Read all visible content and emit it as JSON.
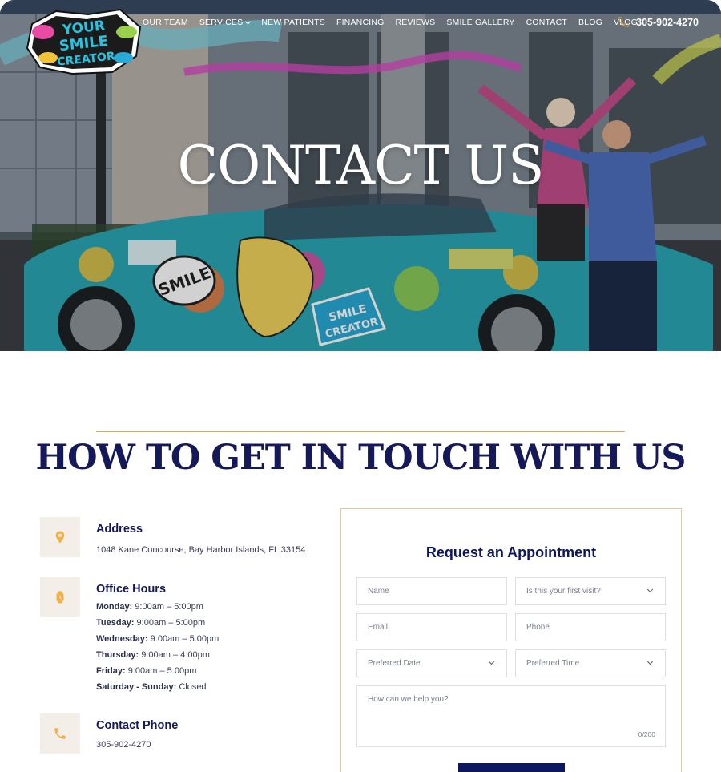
{
  "brand": {
    "logo_lines": [
      "YOUR",
      "SMILE",
      "CREATOR"
    ]
  },
  "nav": {
    "items": [
      {
        "label": "OUR TEAM",
        "has_dropdown": false
      },
      {
        "label": "SERVICES",
        "has_dropdown": true
      },
      {
        "label": "NEW PATIENTS",
        "has_dropdown": false
      },
      {
        "label": "FINANCING",
        "has_dropdown": false
      },
      {
        "label": "REVIEWS",
        "has_dropdown": false
      },
      {
        "label": "SMILE GALLERY",
        "has_dropdown": false
      },
      {
        "label": "CONTACT",
        "has_dropdown": false
      },
      {
        "label": "BLOG",
        "has_dropdown": false
      },
      {
        "label": "VLOG",
        "has_dropdown": false
      }
    ],
    "phone": "305-902-4270",
    "phone_icon": "phone-icon"
  },
  "hero": {
    "title": "CONTACT US",
    "car_text": "SMILE",
    "sticker_text": [
      "SMILE",
      "CREATOR"
    ]
  },
  "section": {
    "title": "HOW TO GET IN TOUCH WITH US"
  },
  "address": {
    "icon": "location-pin-icon",
    "title": "Address",
    "value": "1048 Kane Concourse, Bay Harbor Islands, FL 33154"
  },
  "hours": {
    "icon": "watch-icon",
    "title": "Office Hours",
    "rows": [
      {
        "day": "Monday:",
        "time": "9:00am – 5:00pm"
      },
      {
        "day": "Tuesday:",
        "time": "9:00am – 5:00pm"
      },
      {
        "day": "Wednesday:",
        "time": "9:00am – 5:00pm"
      },
      {
        "day": "Thursday:",
        "time": "9:00am – 4:00pm"
      },
      {
        "day": "Friday:",
        "time": "9:00am – 5:00pm"
      },
      {
        "day": "Saturday - Sunday:",
        "time": "Closed"
      }
    ]
  },
  "contact_phone": {
    "icon": "phone-icon",
    "title": "Contact Phone",
    "value": "305-902-4270"
  },
  "form": {
    "title": "Request an Appointment",
    "name_placeholder": "Name",
    "first_visit_placeholder": "Is this your first visit?",
    "email_placeholder": "Email",
    "phone_placeholder": "Phone",
    "date_placeholder": "Preferred Date",
    "time_placeholder": "Preferred Time",
    "message_placeholder": "How can we help you?",
    "counter": "0/200"
  },
  "colors": {
    "navy": "#15195a",
    "accent_gold": "#d8a860",
    "icon_bg": "#f3efe8",
    "button": "#0d1660"
  }
}
